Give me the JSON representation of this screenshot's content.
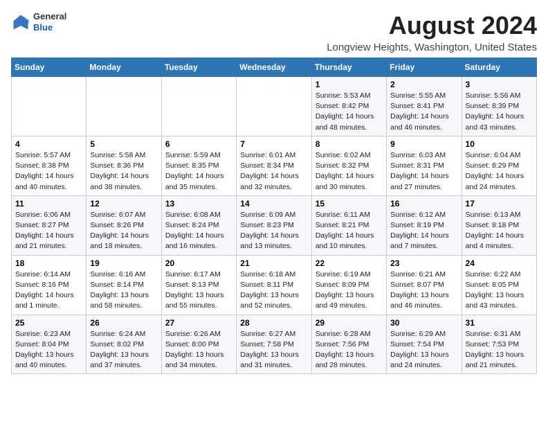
{
  "logo": {
    "general": "General",
    "blue": "Blue"
  },
  "title": "August 2024",
  "subtitle": "Longview Heights, Washington, United States",
  "days_header": [
    "Sunday",
    "Monday",
    "Tuesday",
    "Wednesday",
    "Thursday",
    "Friday",
    "Saturday"
  ],
  "weeks": [
    [
      {
        "day": "",
        "info": ""
      },
      {
        "day": "",
        "info": ""
      },
      {
        "day": "",
        "info": ""
      },
      {
        "day": "",
        "info": ""
      },
      {
        "day": "1",
        "info": "Sunrise: 5:53 AM\nSunset: 8:42 PM\nDaylight: 14 hours\nand 48 minutes."
      },
      {
        "day": "2",
        "info": "Sunrise: 5:55 AM\nSunset: 8:41 PM\nDaylight: 14 hours\nand 46 minutes."
      },
      {
        "day": "3",
        "info": "Sunrise: 5:56 AM\nSunset: 8:39 PM\nDaylight: 14 hours\nand 43 minutes."
      }
    ],
    [
      {
        "day": "4",
        "info": "Sunrise: 5:57 AM\nSunset: 8:38 PM\nDaylight: 14 hours\nand 40 minutes."
      },
      {
        "day": "5",
        "info": "Sunrise: 5:58 AM\nSunset: 8:36 PM\nDaylight: 14 hours\nand 38 minutes."
      },
      {
        "day": "6",
        "info": "Sunrise: 5:59 AM\nSunset: 8:35 PM\nDaylight: 14 hours\nand 35 minutes."
      },
      {
        "day": "7",
        "info": "Sunrise: 6:01 AM\nSunset: 8:34 PM\nDaylight: 14 hours\nand 32 minutes."
      },
      {
        "day": "8",
        "info": "Sunrise: 6:02 AM\nSunset: 8:32 PM\nDaylight: 14 hours\nand 30 minutes."
      },
      {
        "day": "9",
        "info": "Sunrise: 6:03 AM\nSunset: 8:31 PM\nDaylight: 14 hours\nand 27 minutes."
      },
      {
        "day": "10",
        "info": "Sunrise: 6:04 AM\nSunset: 8:29 PM\nDaylight: 14 hours\nand 24 minutes."
      }
    ],
    [
      {
        "day": "11",
        "info": "Sunrise: 6:06 AM\nSunset: 8:27 PM\nDaylight: 14 hours\nand 21 minutes."
      },
      {
        "day": "12",
        "info": "Sunrise: 6:07 AM\nSunset: 8:26 PM\nDaylight: 14 hours\nand 18 minutes."
      },
      {
        "day": "13",
        "info": "Sunrise: 6:08 AM\nSunset: 8:24 PM\nDaylight: 14 hours\nand 16 minutes."
      },
      {
        "day": "14",
        "info": "Sunrise: 6:09 AM\nSunset: 8:23 PM\nDaylight: 14 hours\nand 13 minutes."
      },
      {
        "day": "15",
        "info": "Sunrise: 6:11 AM\nSunset: 8:21 PM\nDaylight: 14 hours\nand 10 minutes."
      },
      {
        "day": "16",
        "info": "Sunrise: 6:12 AM\nSunset: 8:19 PM\nDaylight: 14 hours\nand 7 minutes."
      },
      {
        "day": "17",
        "info": "Sunrise: 6:13 AM\nSunset: 8:18 PM\nDaylight: 14 hours\nand 4 minutes."
      }
    ],
    [
      {
        "day": "18",
        "info": "Sunrise: 6:14 AM\nSunset: 8:16 PM\nDaylight: 14 hours\nand 1 minute."
      },
      {
        "day": "19",
        "info": "Sunrise: 6:16 AM\nSunset: 8:14 PM\nDaylight: 13 hours\nand 58 minutes."
      },
      {
        "day": "20",
        "info": "Sunrise: 6:17 AM\nSunset: 8:13 PM\nDaylight: 13 hours\nand 55 minutes."
      },
      {
        "day": "21",
        "info": "Sunrise: 6:18 AM\nSunset: 8:11 PM\nDaylight: 13 hours\nand 52 minutes."
      },
      {
        "day": "22",
        "info": "Sunrise: 6:19 AM\nSunset: 8:09 PM\nDaylight: 13 hours\nand 49 minutes."
      },
      {
        "day": "23",
        "info": "Sunrise: 6:21 AM\nSunset: 8:07 PM\nDaylight: 13 hours\nand 46 minutes."
      },
      {
        "day": "24",
        "info": "Sunrise: 6:22 AM\nSunset: 8:05 PM\nDaylight: 13 hours\nand 43 minutes."
      }
    ],
    [
      {
        "day": "25",
        "info": "Sunrise: 6:23 AM\nSunset: 8:04 PM\nDaylight: 13 hours\nand 40 minutes."
      },
      {
        "day": "26",
        "info": "Sunrise: 6:24 AM\nSunset: 8:02 PM\nDaylight: 13 hours\nand 37 minutes."
      },
      {
        "day": "27",
        "info": "Sunrise: 6:26 AM\nSunset: 8:00 PM\nDaylight: 13 hours\nand 34 minutes."
      },
      {
        "day": "28",
        "info": "Sunrise: 6:27 AM\nSunset: 7:58 PM\nDaylight: 13 hours\nand 31 minutes."
      },
      {
        "day": "29",
        "info": "Sunrise: 6:28 AM\nSunset: 7:56 PM\nDaylight: 13 hours\nand 28 minutes."
      },
      {
        "day": "30",
        "info": "Sunrise: 6:29 AM\nSunset: 7:54 PM\nDaylight: 13 hours\nand 24 minutes."
      },
      {
        "day": "31",
        "info": "Sunrise: 6:31 AM\nSunset: 7:53 PM\nDaylight: 13 hours\nand 21 minutes."
      }
    ]
  ]
}
